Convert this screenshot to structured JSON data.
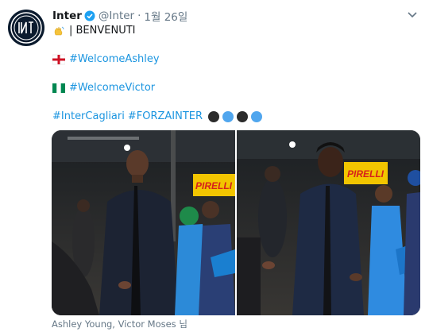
{
  "tweet": {
    "display_name": "Inter",
    "handle": "@Inter",
    "separator": "·",
    "timestamp": "1월 26일",
    "lines": [
      {
        "emoji": "waving-hand",
        "text": " | BENVENUTI"
      },
      {
        "emoji": "england-flag",
        "hashtag": "#WelcomeAshley"
      },
      {
        "emoji": "nigeria-flag",
        "hashtag": "#WelcomeVictor"
      },
      {
        "hashtags": [
          "#InterCagliari",
          "#FORZAINTER"
        ],
        "dots": [
          "#2b2b2b",
          "#50a6ee",
          "#2b2b2b",
          "#50a6ee"
        ]
      }
    ],
    "photos": [
      {
        "description_icon": "player-photo",
        "sponsor_text": "PIRELLI"
      },
      {
        "description_icon": "player-photo",
        "sponsor_text": "PIRELLI"
      }
    ],
    "tagged_users": "Ashley Young, Victor Moses 님"
  },
  "colors": {
    "link": "#1b95e0",
    "secondary_text": "#657786",
    "verified": "#1da1f2",
    "inter_blue": "#0b1b2e"
  }
}
